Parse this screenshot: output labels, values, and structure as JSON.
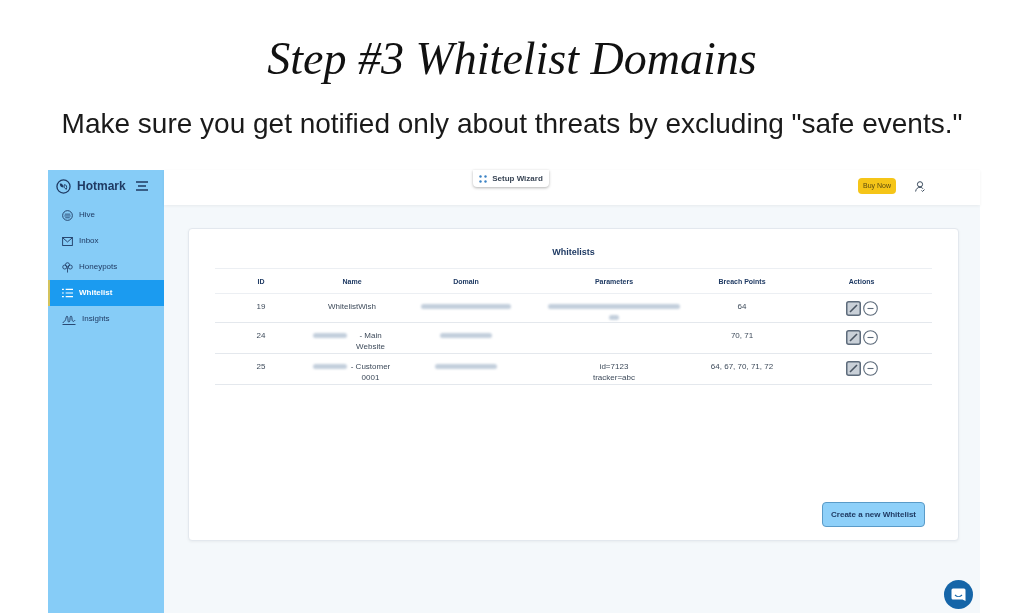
{
  "heading": {
    "title": "Step #3 Whitelist Domains",
    "subtitle": "Make sure you get notified only about threats by excluding \"safe events.\""
  },
  "sidebar": {
    "brand": "Hotmark",
    "items": [
      {
        "label": "Hive",
        "selected": false
      },
      {
        "label": "Inbox",
        "selected": false
      },
      {
        "label": "Honeypots",
        "selected": false
      },
      {
        "label": "Whitelist",
        "selected": true
      },
      {
        "label": "Insights",
        "selected": false
      }
    ]
  },
  "header": {
    "wizard_button": "Setup Wizard",
    "buy_button": "Buy Now"
  },
  "card": {
    "title": "Whitelists",
    "table": {
      "columns": [
        "ID",
        "Name",
        "Domain",
        "Parameters",
        "Breach Points",
        "Actions"
      ],
      "rows": [
        {
          "id": "19",
          "name": {
            "redacted": false,
            "text": "WhitelistWish"
          },
          "domain": {
            "redacted": true
          },
          "parameters": {
            "redacted": true
          },
          "breach_points": "64"
        },
        {
          "id": "24",
          "name": {
            "redacted": true,
            "text": "- Main Website"
          },
          "domain": {
            "redacted": true
          },
          "breach_points": "70, 71"
        },
        {
          "id": "25",
          "name": {
            "redacted": true,
            "text": "- Customer 0001"
          },
          "domain": {
            "redacted": true
          },
          "parameters": {
            "redacted": false,
            "lines": [
              "id=7123",
              "tracker=abc"
            ]
          },
          "breach_points": "64, 67, 70, 71, 72"
        }
      ]
    },
    "create_button": "Create a new Whitelist"
  }
}
